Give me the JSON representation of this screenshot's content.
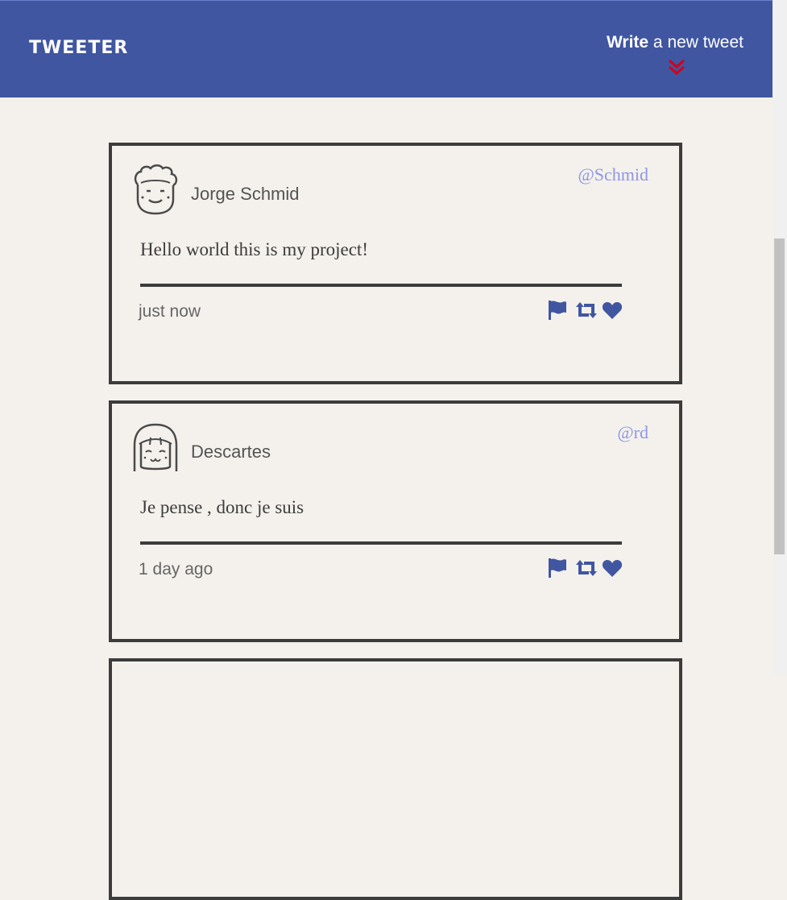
{
  "header": {
    "brand": "TWEETER",
    "compose_bold": "Write",
    "compose_rest": " a new tweet",
    "accent_color": "#4056a1",
    "arrow_color": "#d0021b"
  },
  "tweets": [
    {
      "author": "Jorge Schmid",
      "handle": "@Schmid",
      "content": "Hello world this is my project!",
      "time": "just now",
      "avatar_icon": "curly-hair-face-icon"
    },
    {
      "author": "Descartes",
      "handle": "@rd",
      "content": "Je pense , donc je suis",
      "time": "1 day ago",
      "avatar_icon": "bangs-hair-face-icon"
    }
  ]
}
